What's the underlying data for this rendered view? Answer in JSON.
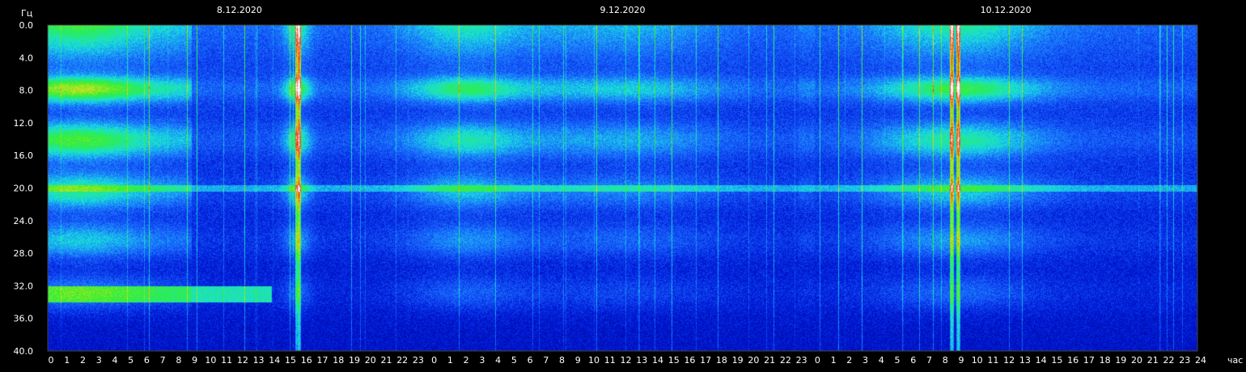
{
  "chart_data": {
    "type": "heatmap",
    "title": "",
    "ylabel": "Гц",
    "xlabel": "час",
    "ylim": [
      0,
      40
    ],
    "y_ticks": [
      "0.0",
      "4.0",
      "8.0",
      "12.0",
      "16.0",
      "20.0",
      "24.0",
      "28.0",
      "32.0",
      "36.0",
      "40.0"
    ],
    "x_ticks": [
      "0",
      "1",
      "2",
      "3",
      "4",
      "5",
      "6",
      "7",
      "8",
      "9",
      "10",
      "11",
      "12",
      "13",
      "14",
      "15",
      "16",
      "17",
      "18",
      "19",
      "20",
      "21",
      "22",
      "23",
      "0",
      "1",
      "2",
      "3",
      "4",
      "5",
      "6",
      "7",
      "8",
      "9",
      "10",
      "11",
      "12",
      "13",
      "14",
      "15",
      "16",
      "17",
      "18",
      "19",
      "20",
      "21",
      "22",
      "23",
      "0",
      "1",
      "2",
      "3",
      "4",
      "5",
      "6",
      "7",
      "8",
      "9",
      "10",
      "11",
      "12",
      "13",
      "14",
      "15",
      "16",
      "17",
      "18",
      "19",
      "20",
      "21",
      "22",
      "23",
      "24"
    ],
    "dates": [
      "8.12.2020",
      "9.12.2020",
      "10.12.2020"
    ],
    "resonance_bands_hz": [
      7.8,
      14.1,
      20.3,
      26.4,
      32.8
    ],
    "colorscale": [
      "#00007a",
      "#0018d8",
      "#1a6bff",
      "#18e0e0",
      "#30f030",
      "#e0e020",
      "#e03010",
      "#ffffff"
    ]
  }
}
